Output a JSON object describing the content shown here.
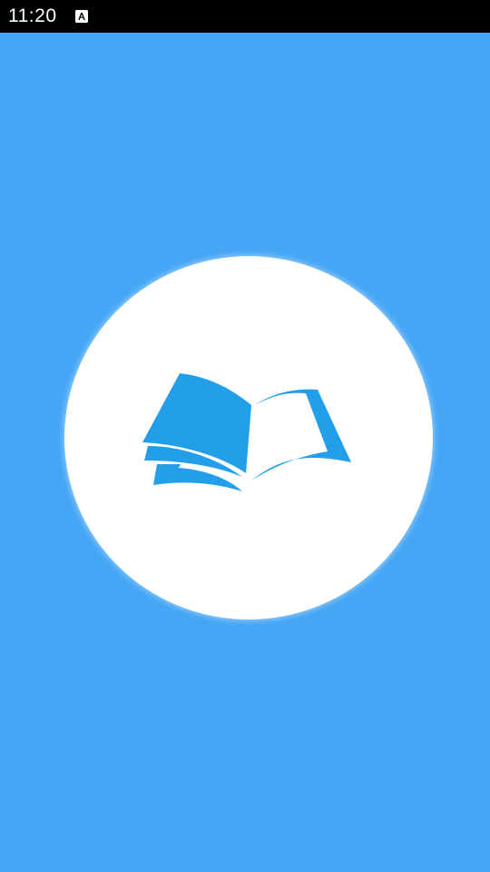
{
  "status_bar": {
    "time": "11:20",
    "notification_icon": "a-letter-icon"
  },
  "splash": {
    "logo_icon": "open-book-icon"
  },
  "colors": {
    "background": "#45A6F5",
    "status_bar": "#000000",
    "circle": "#FFFFFF",
    "book": "#229FE8"
  }
}
